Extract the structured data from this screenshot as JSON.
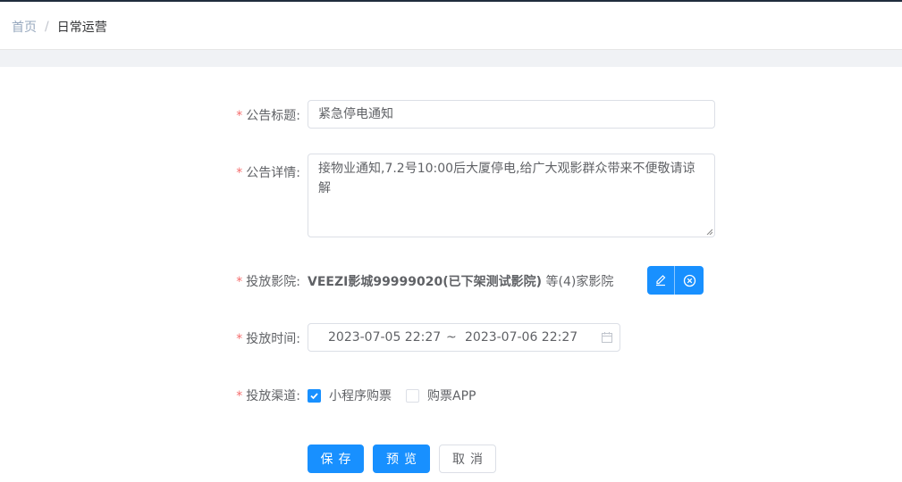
{
  "breadcrumb": {
    "home": "首页",
    "separator": "/",
    "current": "日常运营"
  },
  "form": {
    "title": {
      "required": "*",
      "label": "公告标题:",
      "value": "紧急停电通知"
    },
    "detail": {
      "required": "*",
      "label": "公告详情:",
      "value": "接物业通知,7.2号10:00后大厦停电,给广大观影群众带来不便敬请谅解"
    },
    "cinema": {
      "required": "*",
      "label": "投放影院:",
      "name": "VEEZI影城99999020(已下架测试影院)",
      "suffix": "等(4)家影院",
      "edit_icon": "edit-icon",
      "clear_icon": "close-circle-icon"
    },
    "time": {
      "required": "*",
      "label": "投放时间:",
      "start": "2023-07-05 22:27",
      "separator": "~",
      "end": "2023-07-06 22:27",
      "icon": "calendar-icon"
    },
    "channel": {
      "required": "*",
      "label": "投放渠道:",
      "options": [
        {
          "label": "小程序购票",
          "checked": true
        },
        {
          "label": "购票APP",
          "checked": false
        }
      ]
    }
  },
  "actions": {
    "save": "保存",
    "preview": "预览",
    "cancel": "取消"
  },
  "colors": {
    "primary": "#1890ff",
    "required": "#f56c6c",
    "border": "#dcdfe6"
  }
}
